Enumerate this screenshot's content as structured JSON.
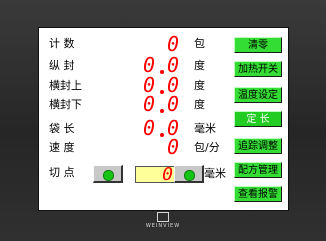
{
  "rows": [
    {
      "label": "计  数",
      "digits": "0",
      "unit": "包"
    },
    {
      "label": "纵  封",
      "digits": [
        "0",
        "0"
      ],
      "unit": "度"
    },
    {
      "label": "横封上",
      "digits": [
        "0",
        "0"
      ],
      "unit": "度"
    },
    {
      "label": "横封下",
      "digits": [
        "0",
        "0"
      ],
      "unit": "度"
    },
    {
      "label": "袋  长",
      "digits": [
        "0",
        "0"
      ],
      "unit": "毫米"
    },
    {
      "label": "速  度",
      "digits": "0",
      "unit": "包/分"
    }
  ],
  "cut_point": {
    "label": "切  点",
    "value": "0",
    "unit": "毫米"
  },
  "side_buttons": [
    "清零",
    "加热开关",
    "温度设定",
    "定  长",
    "追踪调整",
    "配方管理",
    "查看报警"
  ],
  "brand": "WEINVIEW",
  "colors": {
    "value": "#ff0000",
    "button": "#33dd33",
    "cut_box": "#ffff99"
  }
}
